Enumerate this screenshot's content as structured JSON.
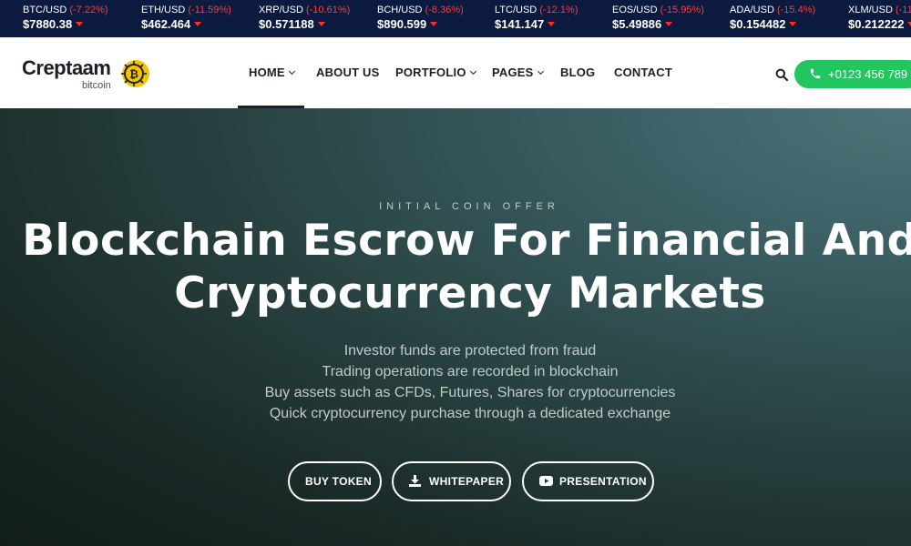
{
  "ticker": [
    {
      "pair": "BTC/USD",
      "change": "(-7.22%)",
      "price": "$7880.38"
    },
    {
      "pair": "ETH/USD",
      "change": "(-11.59%)",
      "price": "$462.464"
    },
    {
      "pair": "XRP/USD",
      "change": "(-10.61%)",
      "price": "$0.571188"
    },
    {
      "pair": "BCH/USD",
      "change": "(-8.36%)",
      "price": "$890.599"
    },
    {
      "pair": "LTC/USD",
      "change": "(-12.1%)",
      "price": "$141.147"
    },
    {
      "pair": "EOS/USD",
      "change": "(-15.95%)",
      "price": "$5.49886"
    },
    {
      "pair": "ADA/USD",
      "change": "(-15.4%)",
      "price": "$0.154482"
    },
    {
      "pair": "XLM/USD",
      "change": "(-11",
      "price": "$0.212222"
    }
  ],
  "logo": {
    "name": "Creptaam",
    "sub": "bitcoin"
  },
  "nav": {
    "home": "HOME",
    "about": "ABOUT US",
    "portfolio": "PORTFOLIO",
    "pages": "PAGES",
    "blog": "BLOG",
    "contact": "CONTACT"
  },
  "header": {
    "phone": "+0123 456 789",
    "accent": "#22c55e"
  },
  "hero": {
    "kicker": "INITIAL COIN OFFER",
    "title_line1": "Blockchain Escrow For Financial And",
    "title_line2": "Cryptocurrency Markets",
    "lines": [
      "Investor funds are protected from fraud",
      "Trading operations are recorded in blockchain",
      "Buy assets such as CFDs, Futures, Shares for cryptocurrencies",
      "Quick cryptocurrency purchase through a dedicated exchange"
    ],
    "buttons": {
      "buy": "BUY TOKEN",
      "whitepaper": "WHITEPAPER",
      "presentation": "PRESENTATION"
    }
  }
}
